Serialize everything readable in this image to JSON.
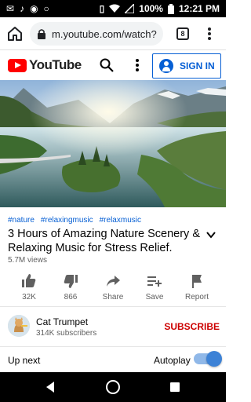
{
  "status_bar": {
    "battery": "100%",
    "time": "12:21 PM"
  },
  "browser": {
    "url": "m.youtube.com/watch?",
    "tab_count": "8"
  },
  "youtube": {
    "logo_text": "YouTube",
    "sign_in_label": "SIGN IN"
  },
  "video": {
    "hashtags": [
      "#nature",
      "#relaxingmusic",
      "#relaxmusic"
    ],
    "title": "3 Hours of Amazing Nature Scenery & Relaxing Music for Stress Relief.",
    "views": "5.7M views"
  },
  "actions": {
    "like_label": "32K",
    "dislike_label": "866",
    "share_label": "Share",
    "save_label": "Save",
    "report_label": "Report"
  },
  "channel": {
    "name": "Cat Trumpet",
    "subscribers": "314K subscribers",
    "subscribe_label": "SUBSCRIBE"
  },
  "up_next": {
    "label": "Up next",
    "autoplay_label": "Autoplay",
    "autoplay_on": true
  },
  "colors": {
    "youtube_red": "#ff0000",
    "link_blue": "#065fd4",
    "subscribe_red": "#cc0000"
  }
}
